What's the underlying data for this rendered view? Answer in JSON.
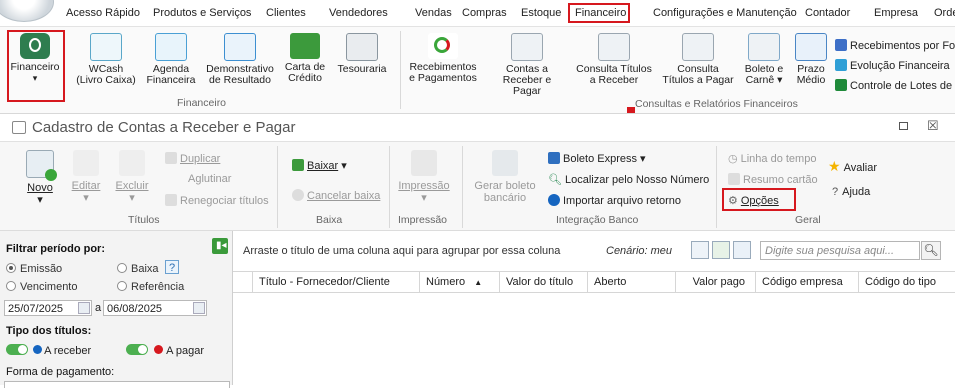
{
  "menubar": {
    "items": [
      "Acesso Rápido",
      "Produtos e Serviços",
      "Clientes",
      "Vendedores",
      "Vendas",
      "Compras",
      "Estoque",
      "Financeiro",
      "Configurações e Manutenção",
      "Contador",
      "Empresa",
      "Orde"
    ]
  },
  "ribbon": {
    "financeiro_label": "Financeiro",
    "wcash_line1": "WCash",
    "wcash_line2": "(Livro Caixa)",
    "agenda_line1": "Agenda",
    "agenda_line2": "Financeira",
    "demonstrativo_line1": "Demonstrativo",
    "demonstrativo_line2": "de Resultado",
    "carta_line1": "Carta de",
    "carta_line2": "Crédito",
    "tesouraria": "Tesouraria",
    "group1_label": "Financeiro",
    "recebimentos_line1": "Recebimentos",
    "recebimentos_line2": "e Pagamentos",
    "contas_line1": "Contas a",
    "contas_line2": "Receber e Pagar",
    "consulta_receber_line1": "Consulta Títulos",
    "consulta_receber_line2": "a Receber",
    "consulta_pagar_line1": "Consulta",
    "consulta_pagar_line2": "Títulos a Pagar",
    "boleto_line1": "Boleto e",
    "boleto_line2": "Carnê",
    "prazo_line1": "Prazo",
    "prazo_line2": "Médio",
    "group2_label": "Consultas e Relatórios Financeiros",
    "recebimentos_forma": "Recebimentos por Form",
    "evolucao": "Evolução Financeira",
    "controle_lotes": "Controle de Lotes de Ca"
  },
  "window": {
    "title": "Cadastro de Contas a Receber e Pagar",
    "novo": "Novo",
    "editar": "Editar",
    "excluir": "Excluir",
    "duplicar": "Duplicar",
    "aglutinar": "Aglutinar",
    "renegociar": "Renegociar títulos",
    "titulos_group": "Títulos",
    "baixar": "Baixar",
    "cancelar_baixa": "Cancelar baixa",
    "baixa_group": "Baixa",
    "impressao": "Impressão",
    "impressao_group": "Impressão",
    "gerar_boleto_line1": "Gerar boleto",
    "gerar_boleto_line2": "bancário",
    "boleto_express": "Boleto Express",
    "localizar": "Localizar pelo Nosso Número",
    "importar": "Importar arquivo retorno",
    "integracao_group": "Integração Banco",
    "linha_tempo": "Linha do tempo",
    "resumo_cartao": "Resumo cartão",
    "opcoes": "Opções",
    "avaliar": "Avaliar",
    "ajuda": "Ajuda",
    "geral_group": "Geral"
  },
  "filter": {
    "periodo_label": "Filtrar período por:",
    "emissao": "Emissão",
    "baixa": "Baixa",
    "help": "?",
    "vencimento": "Vencimento",
    "referencia": "Referência",
    "date_from": "25/07/2025",
    "date_sep": "a",
    "date_to": "06/08/2025",
    "tipo_label": "Tipo dos títulos:",
    "a_receber": "A receber",
    "a_pagar": "A pagar",
    "forma_label": "Forma de pagamento:"
  },
  "grid": {
    "group_hint": "Arraste o título de uma coluna aqui para agrupar por essa coluna",
    "cenario": "Cenário: meu",
    "search_placeholder": "Digite sua pesquisa aqui...",
    "columns": [
      "Título - Fornecedor/Cliente",
      "Número",
      "Valor do título",
      "Aberto",
      "Valor pago",
      "Código empresa",
      "Código do tipo"
    ],
    "sort_arrow": "▲"
  },
  "colors": {
    "accent_red": "#d6181e",
    "green": "#4caf50",
    "blue": "#1565c0"
  }
}
